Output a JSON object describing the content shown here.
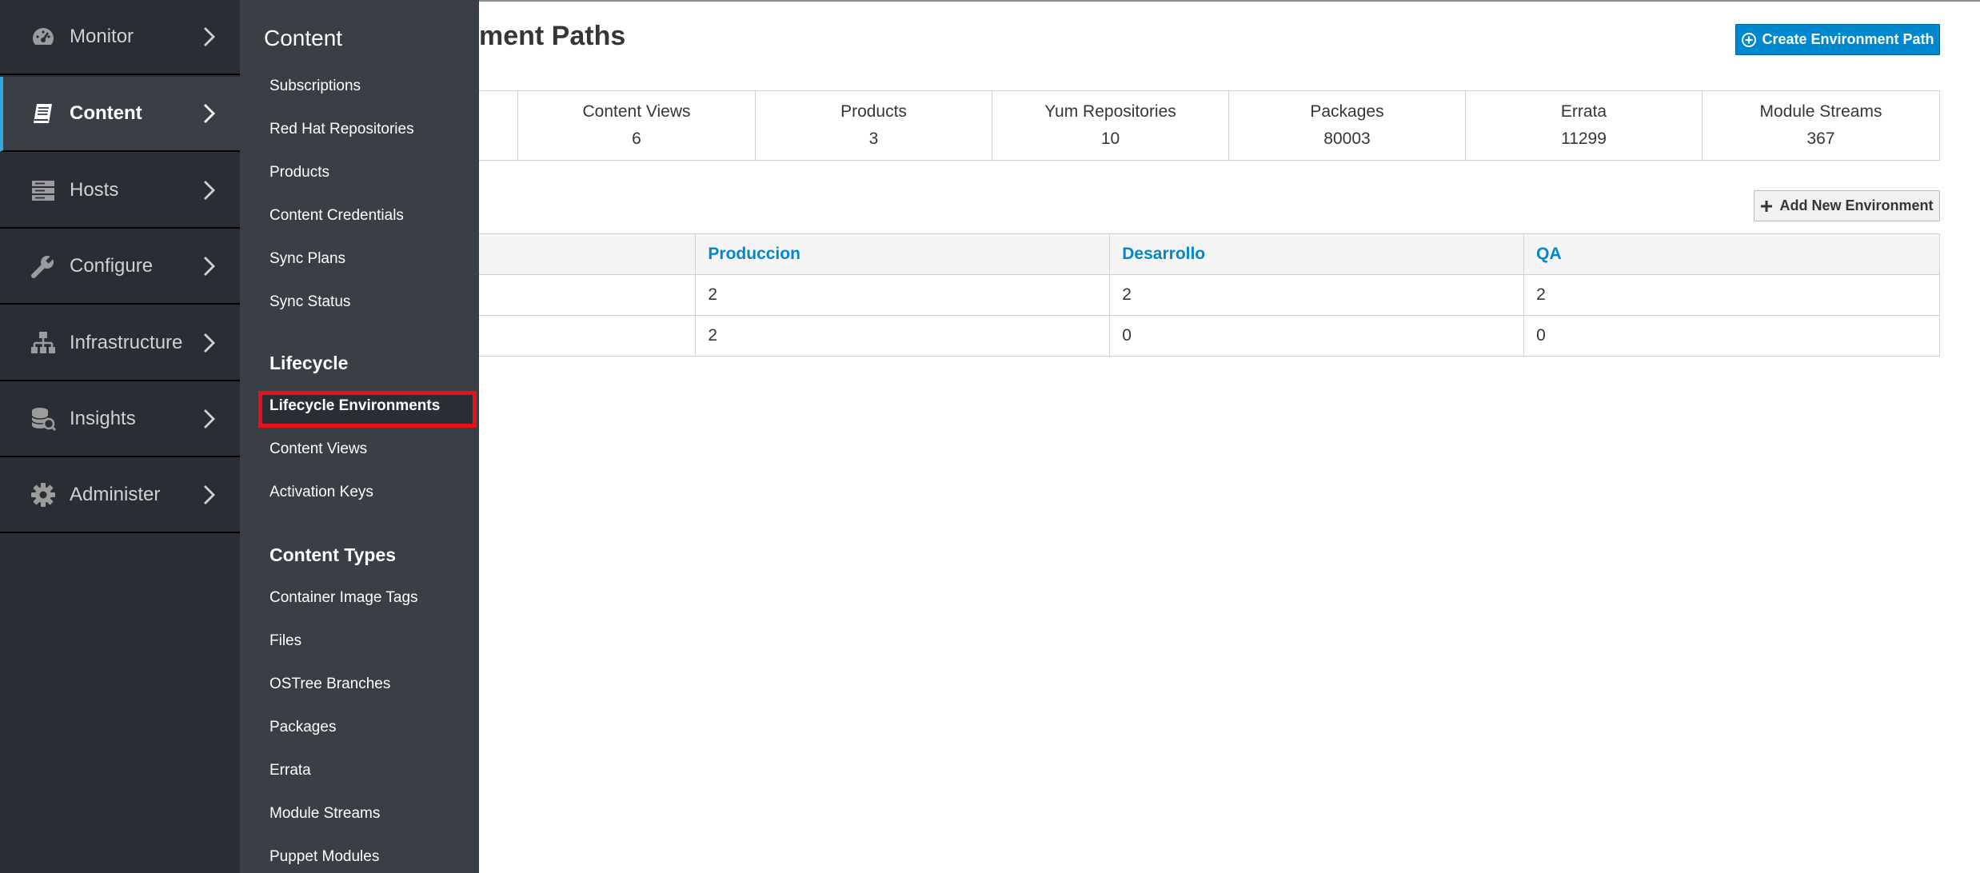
{
  "nav": {
    "items": [
      {
        "label": "Monitor",
        "icon": "dashboard-icon"
      },
      {
        "label": "Content",
        "icon": "book-icon"
      },
      {
        "label": "Hosts",
        "icon": "server-icon"
      },
      {
        "label": "Configure",
        "icon": "wrench-icon"
      },
      {
        "label": "Infrastructure",
        "icon": "network-icon"
      },
      {
        "label": "Insights",
        "icon": "database-search-icon"
      },
      {
        "label": "Administer",
        "icon": "gear-icon"
      }
    ],
    "active": "Content"
  },
  "submenu": {
    "title": "Content",
    "links_content": [
      "Subscriptions",
      "Red Hat Repositories",
      "Products",
      "Content Credentials",
      "Sync Plans",
      "Sync Status"
    ],
    "header_lifecycle": "Lifecycle",
    "links_lifecycle": [
      "Lifecycle Environments",
      "Content Views",
      "Activation Keys"
    ],
    "header_types": "Content Types",
    "links_types": [
      "Container Image Tags",
      "Files",
      "OSTree Branches",
      "Packages",
      "Errata",
      "Module Streams",
      "Puppet Modules"
    ],
    "current": "Lifecycle Environments"
  },
  "page": {
    "title_visible": "ment Paths",
    "create_button": "Create Environment Path",
    "add_button": "Add New Environment"
  },
  "summary": [
    {
      "label": "",
      "value": ""
    },
    {
      "label": "Content Views",
      "value": "6"
    },
    {
      "label": "Products",
      "value": "3"
    },
    {
      "label": "Yum Repositories",
      "value": "10"
    },
    {
      "label": "Packages",
      "value": "80003"
    },
    {
      "label": "Errata",
      "value": "11299"
    },
    {
      "label": "Module Streams",
      "value": "367"
    }
  ],
  "env_table": {
    "headers": [
      "",
      "Produccion",
      "Desarrollo",
      "QA"
    ],
    "rows": [
      [
        "",
        "2",
        "2",
        "2"
      ],
      [
        "",
        "2",
        "0",
        "0"
      ]
    ]
  },
  "colors": {
    "nav_bg": "#292e34",
    "submenu_bg": "#393f44",
    "accent_blue": "#0088ce",
    "active_bar": "#39a5dc",
    "highlight_red": "#e8101a"
  }
}
